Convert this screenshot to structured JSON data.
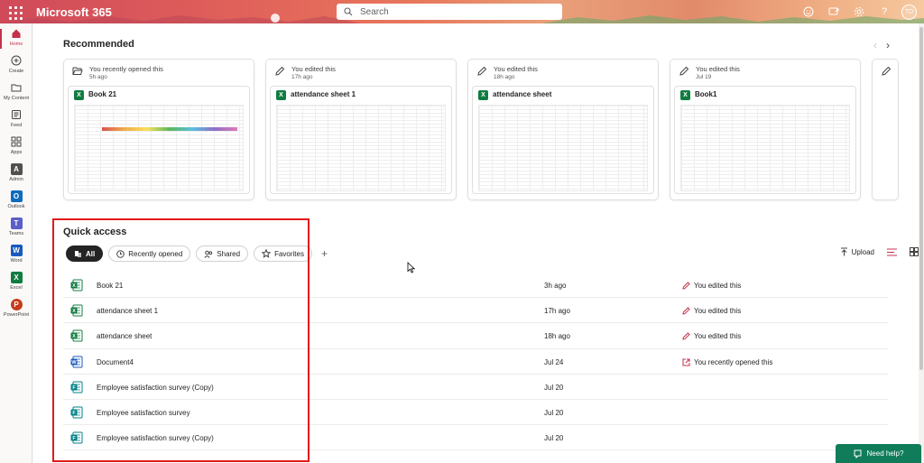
{
  "header": {
    "brand": "Microsoft 365",
    "search_placeholder": "Search",
    "avatar_initials": "TD"
  },
  "rail": [
    {
      "label": "Home",
      "icon": "home-icon"
    },
    {
      "label": "Create",
      "icon": "plus-circle-icon"
    },
    {
      "label": "My Content",
      "icon": "folder-icon"
    },
    {
      "label": "Feed",
      "icon": "feed-icon"
    },
    {
      "label": "Apps",
      "icon": "apps-icon"
    },
    {
      "label": "Admin",
      "icon": "admin-icon"
    },
    {
      "label": "Outlook",
      "icon": "outlook-icon"
    },
    {
      "label": "Teams",
      "icon": "teams-icon"
    },
    {
      "label": "Word",
      "icon": "word-icon"
    },
    {
      "label": "Excel",
      "icon": "excel-icon"
    },
    {
      "label": "PowerPoint",
      "icon": "powerpoint-icon"
    }
  ],
  "recommended": {
    "title": "Recommended",
    "cards": [
      {
        "reason": "You recently opened this",
        "when": "5h ago",
        "file": "Book 21",
        "reason_icon": "folder-open-icon"
      },
      {
        "reason": "You edited this",
        "when": "17h ago",
        "file": "attendance sheet 1",
        "reason_icon": "pencil-icon"
      },
      {
        "reason": "You edited this",
        "when": "18h ago",
        "file": "attendance sheet",
        "reason_icon": "pencil-icon"
      },
      {
        "reason": "You edited this",
        "when": "Jul 19",
        "file": "Book1",
        "reason_icon": "pencil-icon"
      }
    ]
  },
  "quick_access": {
    "title": "Quick access",
    "filters": [
      "All",
      "Recently opened",
      "Shared",
      "Favorites"
    ],
    "upload_label": "Upload",
    "files": [
      {
        "name": "Book 21",
        "date": "3h ago",
        "activity": "You edited this",
        "type": "excel"
      },
      {
        "name": "attendance sheet 1",
        "date": "17h ago",
        "activity": "You edited this",
        "type": "excel"
      },
      {
        "name": "attendance sheet",
        "date": "18h ago",
        "activity": "You edited this",
        "type": "excel"
      },
      {
        "name": "Document4",
        "date": "Jul 24",
        "activity": "You recently opened this",
        "type": "word"
      },
      {
        "name": "Employee satisfaction survey (Copy)",
        "date": "Jul 20",
        "activity": "",
        "type": "forms"
      },
      {
        "name": "Employee satisfaction survey",
        "date": "Jul 20",
        "activity": "",
        "type": "forms"
      },
      {
        "name": "Employee satisfaction survey (Copy)",
        "date": "Jul 20",
        "activity": "",
        "type": "forms"
      }
    ]
  },
  "help_label": "Need help?",
  "colors": {
    "accent": "#c4314b",
    "excel": "#107c41",
    "word": "#185abd",
    "forms": "#038387",
    "highlight": "#e11a1a"
  }
}
